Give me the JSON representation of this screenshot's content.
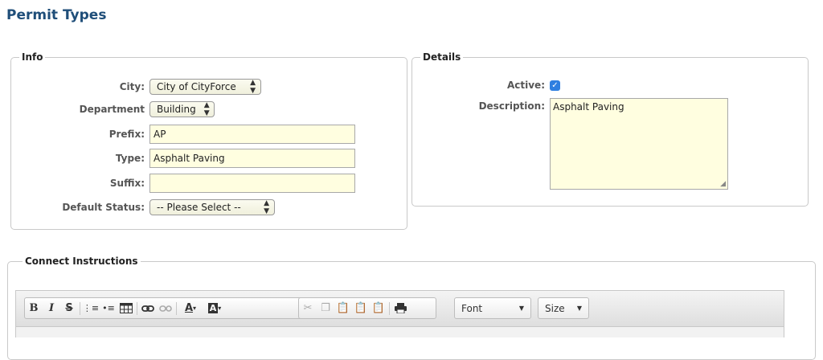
{
  "page": {
    "title": "Permit Types"
  },
  "info": {
    "legend": "Info",
    "city": {
      "label": "City:",
      "value": "City of CityForce"
    },
    "department": {
      "label": "Department",
      "value": "Building"
    },
    "prefix": {
      "label": "Prefix:",
      "value": "AP"
    },
    "type": {
      "label": "Type:",
      "value": "Asphalt Paving"
    },
    "suffix": {
      "label": "Suffix:",
      "value": ""
    },
    "default_status": {
      "label": "Default Status:",
      "value": "-- Please Select --"
    }
  },
  "details": {
    "legend": "Details",
    "active": {
      "label": "Active:",
      "checked": true
    },
    "description": {
      "label": "Description:",
      "value": "Asphalt Paving"
    }
  },
  "connect": {
    "legend": "Connect Instructions",
    "font_label": "Font",
    "size_label": "Size"
  }
}
